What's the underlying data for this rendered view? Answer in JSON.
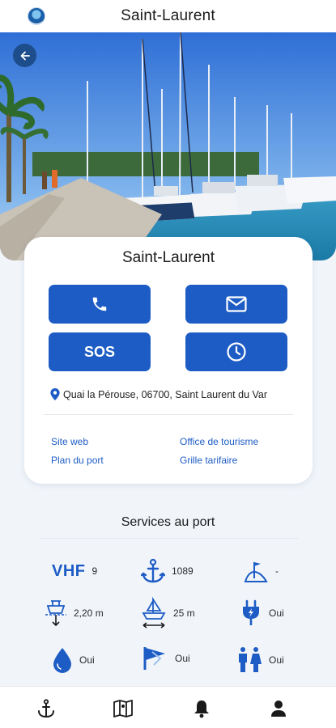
{
  "header": {
    "title": "Saint-Laurent"
  },
  "card": {
    "title": "Saint-Laurent",
    "sos_label": "SOS",
    "address": "Quai la Pérouse, 06700, Saint Laurent du Var",
    "links": {
      "website": "Site web",
      "tourism": "Office de tourisme",
      "port_map": "Plan du port",
      "rates": "Grille tarifaire"
    }
  },
  "services": {
    "title": "Services au port",
    "vhf_label": "VHF",
    "vhf_channel": "9",
    "moorings": "1089",
    "flag_value": "-",
    "max_draft": "2,20 m",
    "max_length": "25 m",
    "electricity": "Oui",
    "water": "Oui",
    "fuel": "Oui",
    "toilets": "Oui"
  },
  "colors": {
    "accent": "#1e5cc5",
    "background": "#f1f5fa",
    "back_button": "#1d4d8a"
  },
  "tabs": [
    "anchor-icon",
    "map-icon",
    "bell-icon",
    "user-icon"
  ]
}
